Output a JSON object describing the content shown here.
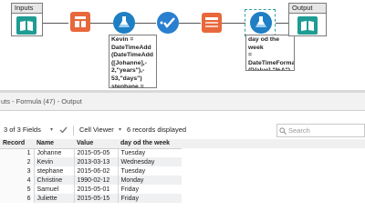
{
  "canvas": {
    "input_container": {
      "title": "Inputs"
    },
    "output_container": {
      "title": "Output"
    },
    "formula1_annotation": "Kevin =\nDateTimeAdd\n(DateTimeAdd\n([Johanne],-\n2,\"years\"),-\n53,\"days\")\nstephane = Dat...",
    "formula2_annotation": "day od the week\n=\nDateTimeFormat\n([Value],\"%A\")"
  },
  "results": {
    "title": "uts - Formula (47) - Output",
    "fields_label": "3 of 3 Fields",
    "viewer_label": "Cell Viewer",
    "records_label": "6 records displayed",
    "search_placeholder": "Search",
    "columns": [
      "Record",
      "Name",
      "Value",
      "day od the week"
    ],
    "rows": [
      {
        "record": "1",
        "name": "Johanne",
        "value": "2015-05-05",
        "day": "Tuesday"
      },
      {
        "record": "2",
        "name": "Kevin",
        "value": "2013-03-13",
        "day": "Wednesday"
      },
      {
        "record": "3",
        "name": "stephane",
        "value": "2015-06-02",
        "day": "Tuesday"
      },
      {
        "record": "4",
        "name": "Christine",
        "value": "1990-02-12",
        "day": "Monday"
      },
      {
        "record": "5",
        "name": "Samuel",
        "value": "2015-05-01",
        "day": "Friday"
      },
      {
        "record": "6",
        "name": "Juliette",
        "value": "2015-05-15",
        "day": "Friday"
      }
    ]
  },
  "colors": {
    "accent_teal": "#1e9c94",
    "formula_blue": "#1f7fc4",
    "orange_tool": "#e8683c",
    "selection": "#2e9e9a"
  },
  "icons": [
    "book-input-icon",
    "select-columns-icon",
    "formula-flask-icon",
    "check-select-icon",
    "data-table-icon",
    "book-output-icon",
    "fields-list-icon",
    "check-icon",
    "search-icon"
  ]
}
